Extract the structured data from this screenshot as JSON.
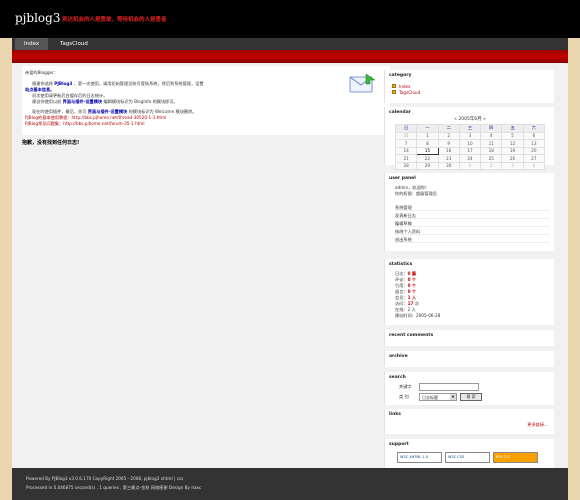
{
  "header": {
    "title": "pjblog3",
    "slogan": "到达机会的人是勇敢，等待机会的人是勇者"
  },
  "nav": {
    "items": [
      "Index",
      "TagsCloud"
    ]
  },
  "welcome": {
    "l1": "亲爱的Blogger：",
    "l2a": "感谢你选择",
    "l2b": "PJBlog3",
    "l2c": "，第一次使用，请用初始管理员账号登陆系统，然后到系统管理，设置",
    "l3": "站点基本信息。",
    "l4": "初次使用请更新后台缓存后的日志统计。",
    "l5": "建议你使用以前",
    "l5b": "界面与插件-设置模块",
    "l5c": "编辑模块标识为 BlogInfo 的模块即可。",
    "l6a": "现在的使用插件，最后，你可",
    "l6b": "界面与插件-设置模块",
    "l6c": "的模块标识为 Welcome 模块删除。",
    "l7": "PJBlog的基本使用教程：http://bbs.pjhome.net/thread-30520-1-1.html",
    "l8": "PJBlog常见问题集：http://bbs.pjhome.net/forum-35-1.html"
  },
  "notfound": "抱歉，没有找到任何日志!",
  "category": {
    "title": "category",
    "items": [
      "Index",
      "TagsCloud"
    ]
  },
  "calendar": {
    "title": "calendar",
    "month": "« 2005年6月 »",
    "weekdays": [
      "日",
      "一",
      "二",
      "三",
      "四",
      "五",
      "六"
    ],
    "weeks": [
      [
        "31",
        "1",
        "2",
        "3",
        "4",
        "5",
        "6"
      ],
      [
        "7",
        "8",
        "9",
        "10",
        "11",
        "12",
        "13"
      ],
      [
        "14",
        "15",
        "16",
        "17",
        "18",
        "19",
        "20"
      ],
      [
        "21",
        "22",
        "23",
        "24",
        "25",
        "26",
        "27"
      ],
      [
        "28",
        "29",
        "30",
        "1",
        "2",
        "3",
        "4"
      ]
    ]
  },
  "userpanel": {
    "title": "user panel",
    "greet": "admin，欢迎你！",
    "role": "你的权限：超级管理员",
    "links": [
      "系统管理",
      "发表新日志",
      "编辑草稿",
      "修改个人资料",
      "退出系统"
    ]
  },
  "statistics": {
    "title": "statistics",
    "rows": [
      [
        "日志",
        "0",
        "篇"
      ],
      [
        "评论",
        "0",
        "个"
      ],
      [
        "引用",
        "0",
        "个"
      ],
      [
        "留言",
        "0",
        "个"
      ],
      [
        "会员",
        "1",
        "人"
      ],
      [
        "访问",
        "17",
        "次"
      ],
      [
        "在线",
        "2",
        "人"
      ],
      [
        "建站时间",
        "2005-06-28",
        ""
      ]
    ]
  },
  "recent": {
    "title": "recent comments"
  },
  "archive": {
    "title": "archive"
  },
  "search": {
    "title": "search",
    "kw_label": "关键字",
    "cat_label": "类 别",
    "option": "日志标题",
    "button": "搜 索"
  },
  "links": {
    "title": "links",
    "more": "更多链接..."
  },
  "support": {
    "title": "support",
    "badges": [
      "W3C XHTML 1.0",
      "W3C CSS",
      "RSS 2.0"
    ]
  },
  "footer": {
    "l1": "Powered By PJBlog3 v3.0.6.170 CopyRight 2005 - 2008, pjblog3 xhtml | css",
    "l2": "Processed in 0.046875 second(s) , 1 queries , 第三最点-金秋 网络感谢 Design By haxc"
  },
  "colors": {
    "accent": "#c00000",
    "link": "#0000b0"
  }
}
